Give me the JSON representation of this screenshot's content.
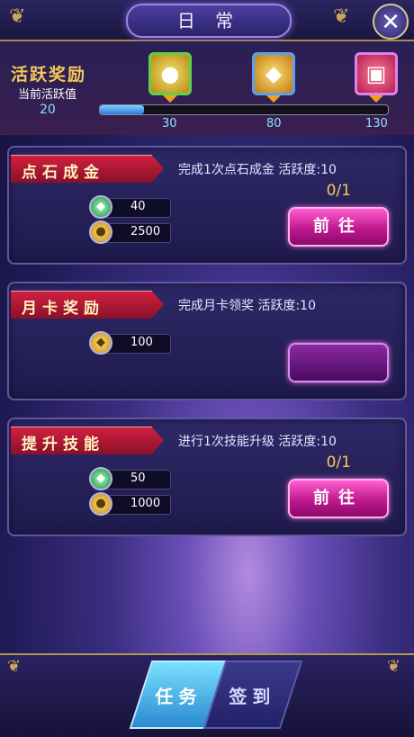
{
  "header": {
    "title": "日 常",
    "close_glyph": "✕"
  },
  "activity": {
    "title": "活跃奖励",
    "current_label": "当前活跃值",
    "current_value": "20",
    "progress": 0.154,
    "milestones": [
      {
        "icon": "coin-icon",
        "glyph": "●",
        "value": "30"
      },
      {
        "icon": "gold-ingot-icon",
        "glyph": "◆",
        "value": "80"
      },
      {
        "icon": "gift-box-icon",
        "glyph": "▣",
        "value": "130"
      }
    ]
  },
  "tasks": [
    {
      "name": "点石成金",
      "desc": "完成1次点石成金 活跃度:10",
      "rewards": [
        {
          "icon": "gem-icon",
          "glyph": "◆",
          "value": "40"
        },
        {
          "icon": "coin-icon",
          "glyph": "●",
          "value": "2500"
        }
      ],
      "progress": "0/1",
      "button": "前往"
    },
    {
      "name": "月卡奖励",
      "desc": "完成月卡领奖 活跃度:10",
      "rewards": [
        {
          "icon": "gold-ingot-icon",
          "glyph": "◆",
          "value": "100"
        }
      ],
      "progress": "",
      "button": ""
    },
    {
      "name": "提升技能",
      "desc": "进行1次技能升级 活跃度:10",
      "rewards": [
        {
          "icon": "gem-icon",
          "glyph": "◆",
          "value": "50"
        },
        {
          "icon": "coin-icon",
          "glyph": "●",
          "value": "1000"
        }
      ],
      "progress": "0/1",
      "button": "前往"
    }
  ],
  "tabs": [
    {
      "label": "任务",
      "active": true
    },
    {
      "label": "签到",
      "active": false
    }
  ]
}
